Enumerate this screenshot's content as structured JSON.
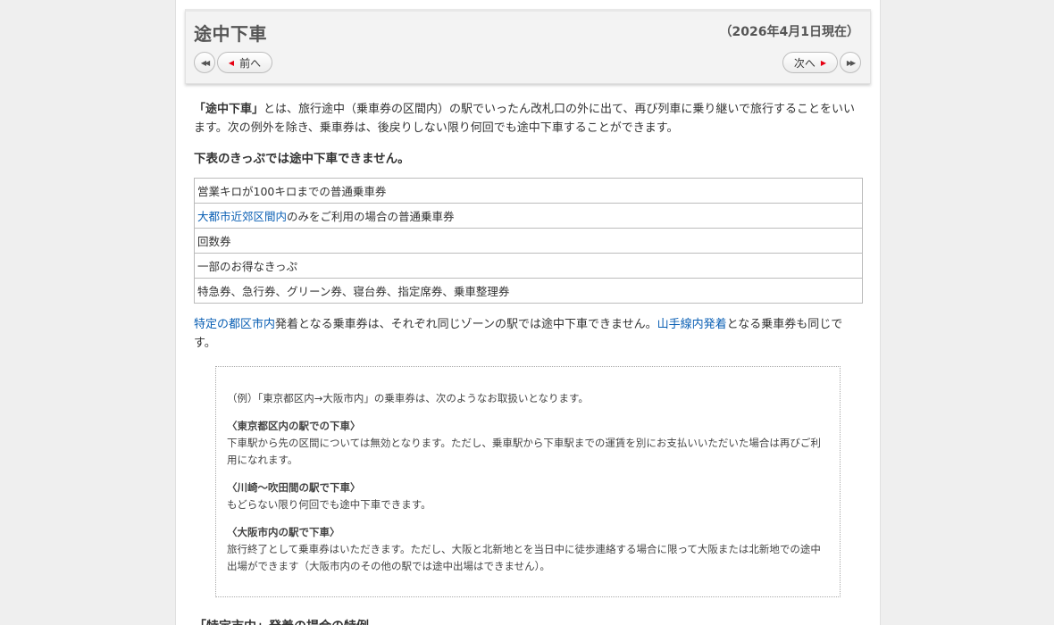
{
  "header": {
    "title": "途中下車",
    "date": "（2026年4月1日現在）",
    "prev_label": "前へ",
    "next_label": "次へ"
  },
  "intro": {
    "term": "「途中下車」",
    "text": "とは、旅行途中（乗車券の区間内）の駅でいったん改札口の外に出て、再び列車に乗り継いで旅行することをいいます。次の例外を除き、乗車券は、後戻りしない限り何回でも途中下車することができます。"
  },
  "restriction_heading": "下表のきっぷでは途中下車できません。",
  "tickets": [
    {
      "text": "営業キロが100キロまでの普通乗車券"
    },
    {
      "link": "大都市近郊区間内",
      "text": "のみをご利用の場合の普通乗車券"
    },
    {
      "text": "回数券"
    },
    {
      "text": "一部のお得なきっぷ"
    },
    {
      "text": "特急券、急行券、グリーン券、寝台券、指定席券、乗車整理券"
    }
  ],
  "note": {
    "link1": "特定の都区市内",
    "text1": "発着となる乗車券は、それぞれ同じゾーンの駅では途中下車できません。",
    "link2": "山手線内発着",
    "text2": "となる乗車券も同じです。"
  },
  "example": {
    "intro": "（例）「東京都区内→大阪市内」の乗車券は、次のようなお取扱いとなります。",
    "cases": [
      {
        "head": "〈東京都区内の駅での下車〉",
        "body": "下車駅から先の区間については無効となります。ただし、乗車駅から下車駅までの運賃を別にお支払いいただいた場合は再びご利用になれます。"
      },
      {
        "head": "〈川崎〜吹田間の駅で下車〉",
        "body": "もどらない限り何回でも途中下車できます。"
      },
      {
        "head": "〈大阪市内の駅で下車〉",
        "body": "旅行終了として乗車券はいただきます。ただし、大阪と北新地とを当日中に徒歩連絡する場合に限って大阪または北新地での途中出場ができます（大阪市内のその他の駅では途中出場はできません）。"
      }
    ]
  },
  "next_section_heading": "「特定市内」発着の場合の特例",
  "colors": {
    "link": "#0a5fb4",
    "nav_arrow": "#e60012",
    "header_bg": "#f3f3f3"
  },
  "icons": {
    "first": "double-left-icon",
    "prev": "caret-left-icon",
    "next": "caret-right-icon",
    "last": "double-right-icon"
  }
}
